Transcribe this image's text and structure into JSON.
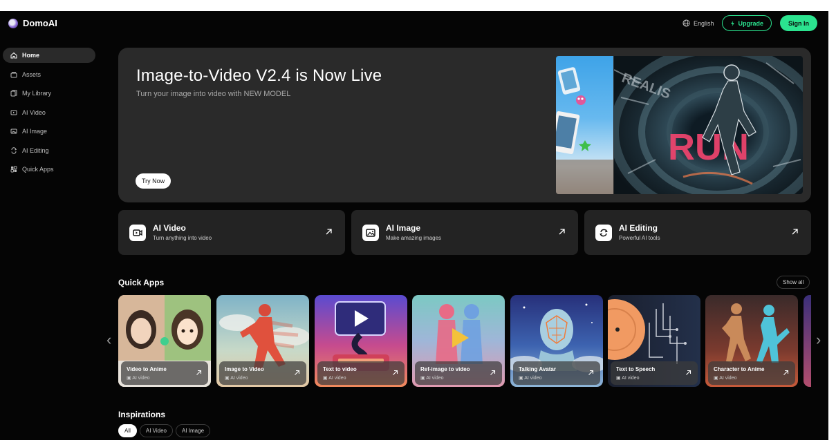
{
  "brand": {
    "name": "DomoAI"
  },
  "topbar": {
    "language": "English",
    "upgrade_label": "Upgrade",
    "signin_label": "Sign In"
  },
  "sidebar": {
    "items": [
      {
        "label": "Home",
        "icon": "home-icon",
        "active": true
      },
      {
        "label": "Assets",
        "icon": "assets-icon"
      },
      {
        "label": "My Library",
        "icon": "library-icon"
      },
      {
        "label": "AI Video",
        "icon": "video-icon"
      },
      {
        "label": "AI Image",
        "icon": "image-icon"
      },
      {
        "label": "AI Editing",
        "icon": "editing-icon"
      },
      {
        "label": "Quick Apps",
        "icon": "apps-icon"
      }
    ]
  },
  "hero": {
    "title": "Image-to-Video V2.4 is Now Live",
    "subtitle": "Turn your image into video with NEW MODEL",
    "cta": "Try Now",
    "art_text": "RUN"
  },
  "features": [
    {
      "title": "AI Video",
      "subtitle": "Turn anything into video",
      "icon": "video-camera-icon"
    },
    {
      "title": "AI Image",
      "subtitle": "Make amazing images",
      "icon": "image-icon"
    },
    {
      "title": "AI Editing",
      "subtitle": "Powerful AI tools",
      "icon": "editing-icon"
    }
  ],
  "quick_apps": {
    "title": "Quick Apps",
    "show_all": "Show all",
    "items": [
      {
        "name": "Video to Anime",
        "type": "AI video"
      },
      {
        "name": "Image to Video",
        "type": "AI video"
      },
      {
        "name": "Text to video",
        "type": "AI video"
      },
      {
        "name": "Ref-image to video",
        "type": "AI video"
      },
      {
        "name": "Talking Avatar",
        "type": "AI video"
      },
      {
        "name": "Text to Speech",
        "type": "AI video"
      },
      {
        "name": "Character to Anime",
        "type": "AI video"
      }
    ]
  },
  "inspirations": {
    "title": "Inspirations",
    "tabs": [
      {
        "label": "All",
        "active": true
      },
      {
        "label": "AI Video"
      },
      {
        "label": "AI Image"
      }
    ]
  },
  "colors": {
    "accent": "#2be38f",
    "background": "#050505",
    "card": "#232323",
    "hero": "#2a2a2a"
  }
}
